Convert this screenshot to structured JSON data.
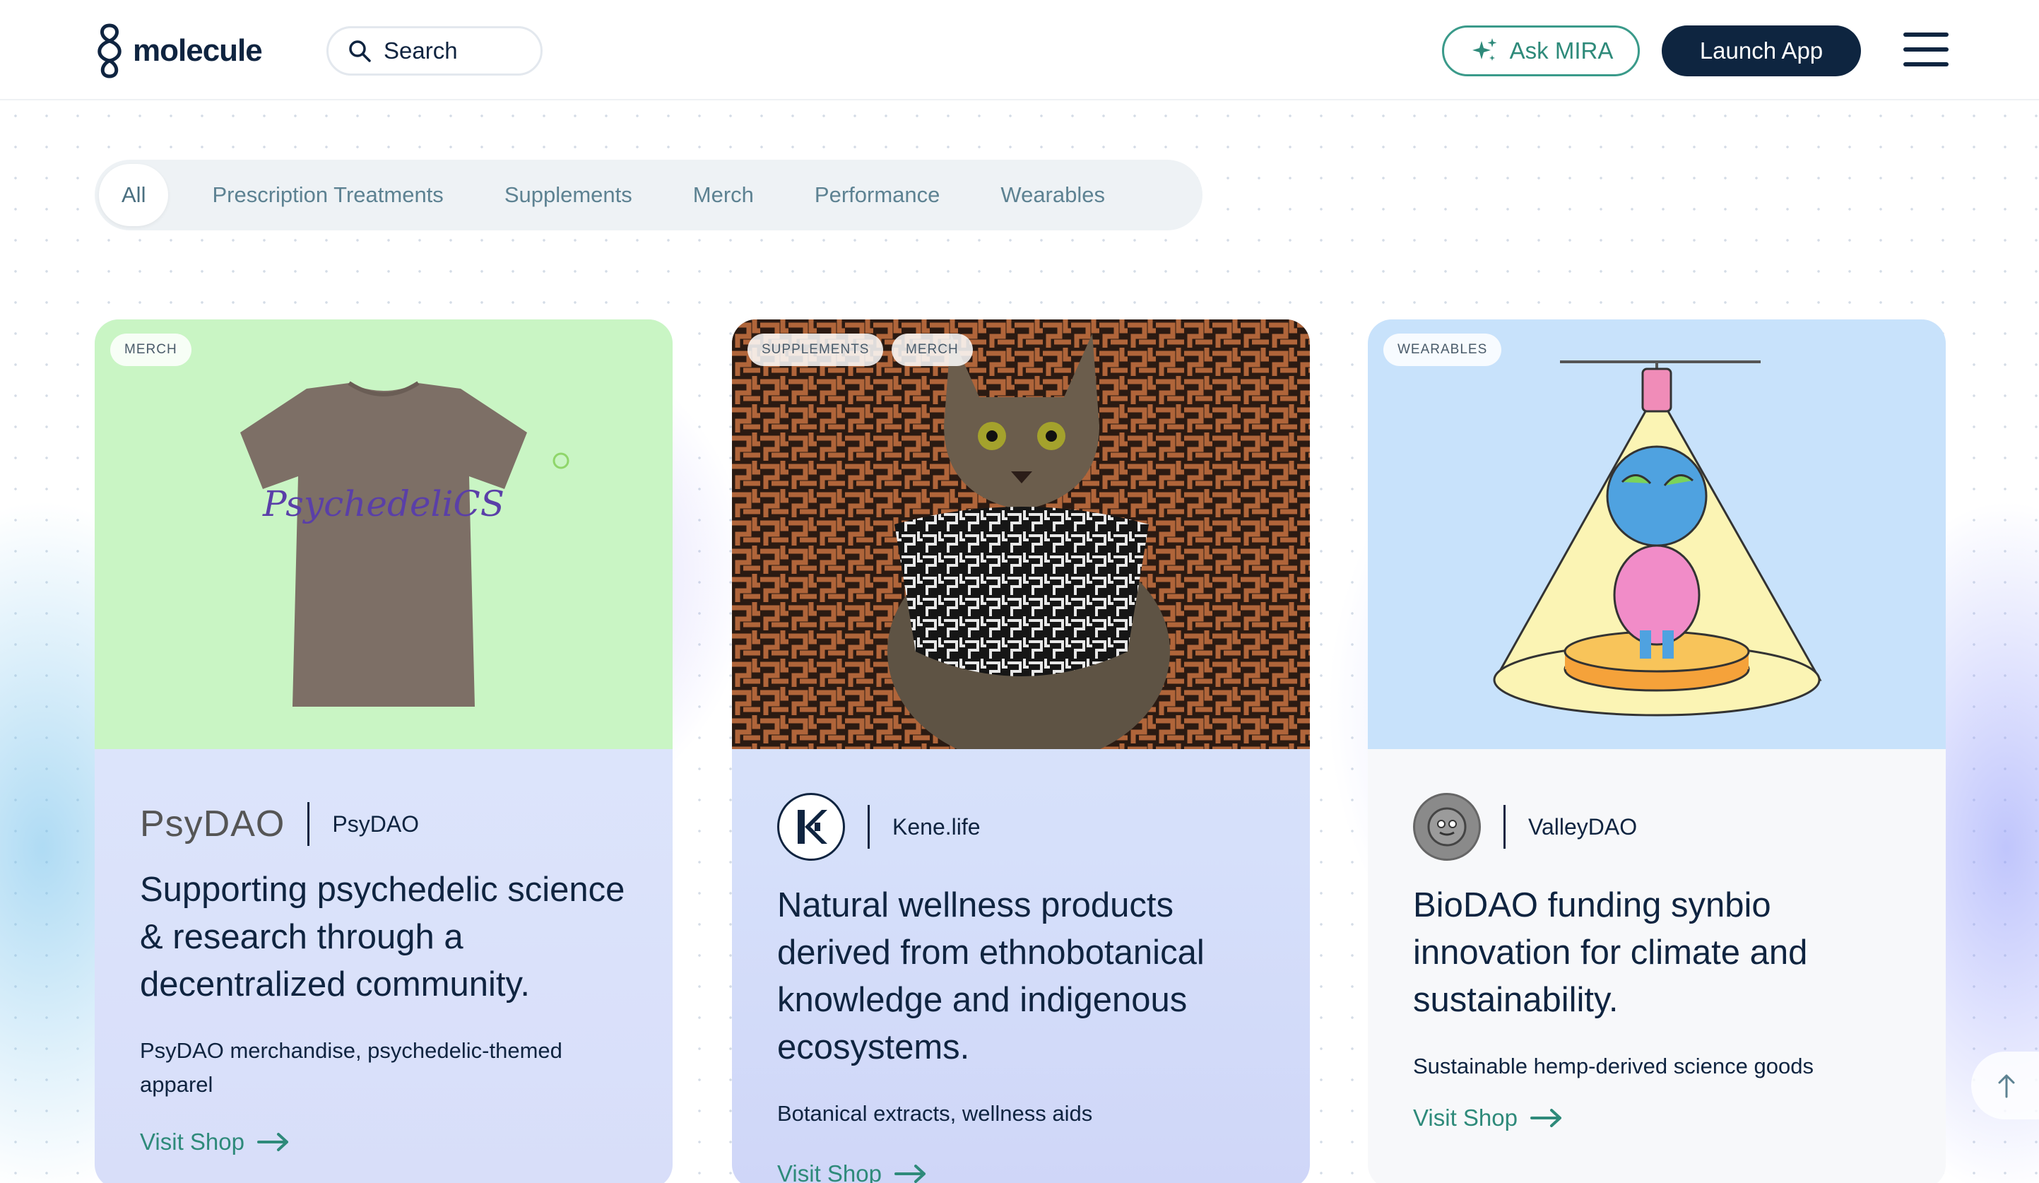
{
  "header": {
    "logo_text": "molecule",
    "search_label": "Search",
    "ask_label": "Ask MIRA",
    "launch_label": "Launch App"
  },
  "filters": {
    "tabs": [
      "All",
      "Prescription Treatments",
      "Supplements",
      "Merch",
      "Performance",
      "Wearables"
    ],
    "active": "All"
  },
  "cards": [
    {
      "tags": [
        "MERCH"
      ],
      "brand_logo_text": "PsyDAO",
      "brand_name": "PsyDAO",
      "headline": "Supporting psychedelic science & research through a decentralized community.",
      "description": "PsyDAO merchandise, psychedelic-themed apparel",
      "link_label": "Visit Shop",
      "image_bg": "#c9f5c4",
      "image_text": "PsychedeliCS"
    },
    {
      "tags": [
        "SUPPLEMENTS",
        "MERCH"
      ],
      "brand_name": "Kene.life",
      "headline": "Natural wellness products derived from ethnobotanical knowledge and indigenous ecosystems.",
      "description": "Botanical extracts, wellness aids",
      "link_label": "Visit Shop"
    },
    {
      "tags": [
        "WEARABLES"
      ],
      "brand_name": "ValleyDAO",
      "headline": "BioDAO funding synbio innovation for climate and sustainability.",
      "description": "Sustainable hemp-derived science goods",
      "link_label": "Visit Shop",
      "image_bg": "#c8e2fb"
    }
  ],
  "colors": {
    "navy": "#0e2540",
    "teal": "#2e8a7a",
    "tab_text": "#5d8292"
  }
}
